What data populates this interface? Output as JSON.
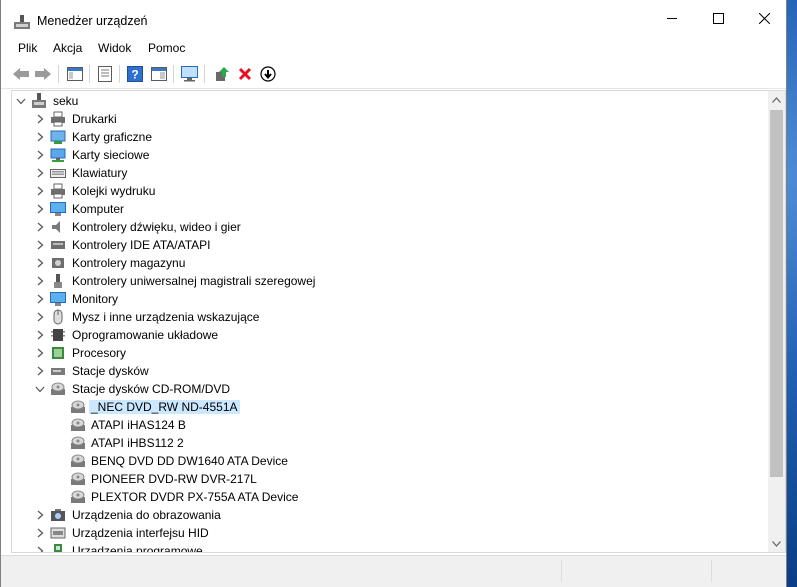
{
  "window": {
    "title": "Menedżer urządzeń"
  },
  "menu": [
    "Plik",
    "Akcja",
    "Widok",
    "Pomoc"
  ],
  "toolbar": [
    "back-icon",
    "forward-icon",
    "console-tree-icon",
    "properties-icon",
    "help-icon",
    "show-view-icon",
    "scan-hardware-icon",
    "update-driver-icon",
    "uninstall-icon",
    "disable-icon"
  ],
  "tree": {
    "root": "seku",
    "items": [
      {
        "label": "Drukarki",
        "icon": "printer-icon"
      },
      {
        "label": "Karty graficzne",
        "icon": "display-adapter-icon"
      },
      {
        "label": "Karty sieciowe",
        "icon": "network-adapter-icon"
      },
      {
        "label": "Klawiatury",
        "icon": "keyboard-icon"
      },
      {
        "label": "Kolejki wydruku",
        "icon": "print-queue-icon"
      },
      {
        "label": "Komputer",
        "icon": "computer-icon"
      },
      {
        "label": "Kontrolery dźwięku, wideo i gier",
        "icon": "speaker-icon"
      },
      {
        "label": "Kontrolery IDE ATA/ATAPI",
        "icon": "ide-controller-icon"
      },
      {
        "label": "Kontrolery magazynu",
        "icon": "storage-controller-icon"
      },
      {
        "label": "Kontrolery uniwersalnej magistrali szeregowej",
        "icon": "usb-icon"
      },
      {
        "label": "Monitory",
        "icon": "monitor-icon"
      },
      {
        "label": "Mysz i inne urządzenia wskazujące",
        "icon": "mouse-icon"
      },
      {
        "label": "Oprogramowanie układowe",
        "icon": "firmware-icon"
      },
      {
        "label": "Procesory",
        "icon": "processor-icon"
      },
      {
        "label": "Stacje dysków",
        "icon": "disk-drive-icon"
      },
      {
        "label": "Stacje dysków CD-ROM/DVD",
        "icon": "cdrom-icon",
        "expanded": true,
        "children": [
          "_NEC DVD_RW ND-4551A",
          "ATAPI iHAS124   B",
          "ATAPI iHBS112   2",
          "BENQ DVD DD DW1640 ATA Device",
          "PIONEER DVD-RW  DVR-217L",
          "PLEXTOR DVDR   PX-755A ATA Device"
        ]
      },
      {
        "label": "Urządzenia do obrazowania",
        "icon": "camera-icon"
      },
      {
        "label": "Urządzenia interfejsu HID",
        "icon": "hid-icon"
      },
      {
        "label": "Urządzenia programowe",
        "icon": "software-device-icon"
      }
    ],
    "selected": "_NEC DVD_RW ND-4551A"
  },
  "colors": {
    "selection": "#cce8ff",
    "scroll_thumb": "#c1c1c1",
    "uninstall_red": "#e81123"
  }
}
